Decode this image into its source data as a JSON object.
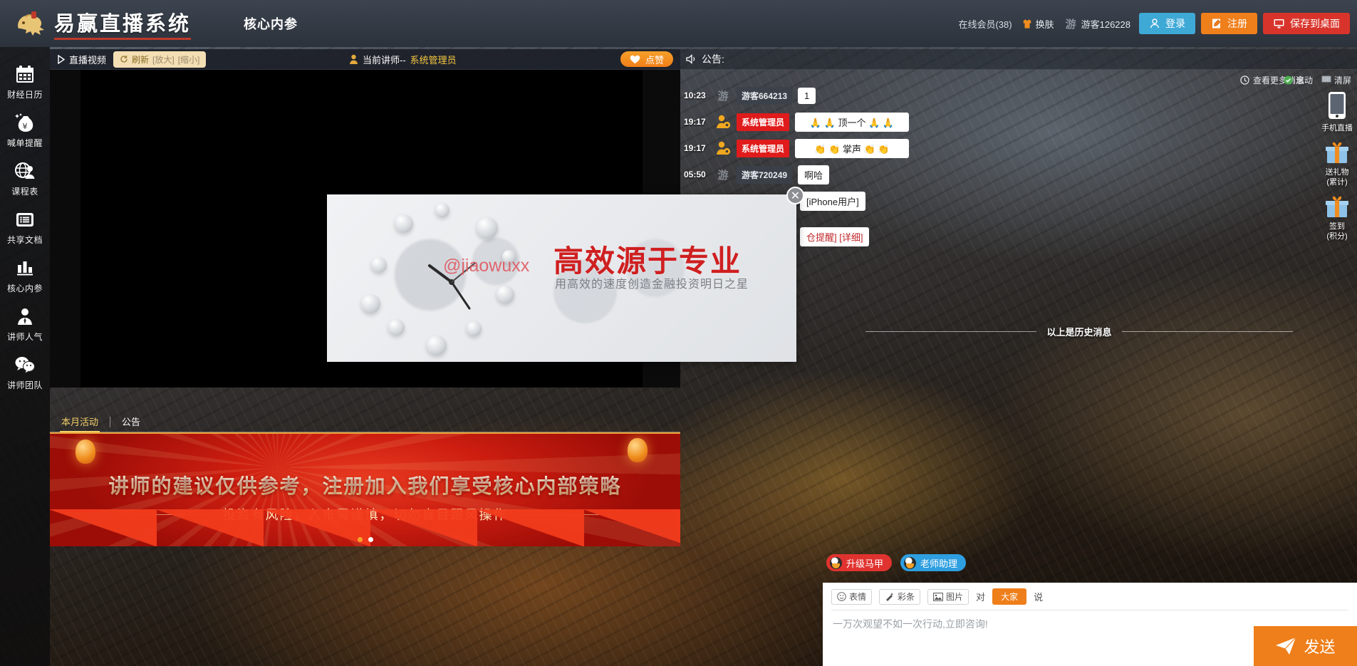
{
  "header": {
    "brand": "易赢直播系统",
    "subtitle": "核心内参",
    "online_members": "在线会员(38)",
    "skin_label": "换肤",
    "guest_badge": "游",
    "guest_name": "游客126228",
    "login_label": "登录",
    "register_label": "注册",
    "save_desktop_label": "保存到桌面"
  },
  "sidebar": {
    "items": [
      {
        "label": "财经日历",
        "icon": "calendar-icon"
      },
      {
        "label": "喊单提醒",
        "icon": "money-bag-icon"
      },
      {
        "label": "课程表",
        "icon": "globe-person-icon"
      },
      {
        "label": "共享文档",
        "icon": "document-list-icon"
      },
      {
        "label": "核心内参",
        "icon": "bar-chart-icon"
      },
      {
        "label": "讲师人气",
        "icon": "person-icon"
      },
      {
        "label": "讲师团队",
        "icon": "wechat-icon"
      }
    ]
  },
  "video": {
    "toolbar_title": "直播视频",
    "refresh_label": "刷新",
    "zoom_in_label": "[放大]",
    "zoom_out_label": "[缩小]",
    "teacher_prefix": "当前讲师--",
    "teacher_name": "系统管理员",
    "like_label": "点赞"
  },
  "popup": {
    "headline": "高效源于专业",
    "subline": "用高效的速度创造金融投资明日之星",
    "watermark": "@jiaowuxx",
    "close_label": "✕"
  },
  "tabs": {
    "items": [
      {
        "label": "本月活动",
        "active": true
      },
      {
        "label": "公告",
        "active": false
      }
    ]
  },
  "banner": {
    "title": "讲师的建议仅供参考，注册加入我们享受核心内部策略",
    "subtitle": "投资有风险，入市需谨慎，切勿盲目跟风操作",
    "dots": 2,
    "active_dot": 1
  },
  "chat": {
    "panel_title": "公告:",
    "more_messages": "查看更多消息",
    "scroll_label": "滚动",
    "clear_label": "清屏",
    "history_divider": "以上是历史消息",
    "messages": [
      {
        "time": "10:23",
        "avatar": "guest",
        "badge": "游",
        "name": "游客664213",
        "name_style": "guest",
        "text": "1"
      },
      {
        "time": "19:17",
        "avatar": "admin",
        "badge": "",
        "name": "系统管理员",
        "name_style": "admin",
        "text": "🙏 🙏 顶一个 🙏 🙏"
      },
      {
        "time": "19:17",
        "avatar": "admin",
        "badge": "",
        "name": "系统管理员",
        "name_style": "admin",
        "text": "👏 👏 掌声 👏 👏"
      },
      {
        "time": "05:50",
        "avatar": "guest",
        "badge": "游",
        "name": "游客720249",
        "name_style": "guest",
        "text": "啊哈"
      }
    ],
    "occluded_messages": [
      {
        "text": "[iPhone用户]"
      },
      {
        "text": "仓提醒] [详细]"
      }
    ]
  },
  "rail": {
    "items": [
      {
        "label": "手机直播",
        "icon": "phone-icon"
      },
      {
        "label": "送礼物\n(累计)",
        "icon": "gift-icon"
      },
      {
        "label": "签到\n(积分)",
        "icon": "gift-icon"
      }
    ],
    "phone_label": "手机直播",
    "gift_label": "送礼物",
    "gift_sub": "(累计)",
    "signin_label": "签到",
    "signin_sub": "(积分)"
  },
  "quick_buttons": [
    {
      "label": "升级马甲",
      "color": "#e0332f"
    },
    {
      "label": "老师助理",
      "color": "#2e9fe0"
    }
  ],
  "input": {
    "emoji_label": "表情",
    "color_label": "彩条",
    "image_label": "图片",
    "to_label": "对",
    "target_label": "大家",
    "say_label": "说",
    "placeholder": "一万次观望不如一次行动,立即咨询!",
    "send_label": "发送"
  },
  "colors": {
    "accent_orange": "#ef7f1a",
    "accent_red": "#d9342b",
    "accent_blue": "#3fa9d6",
    "gold": "#f5c842"
  }
}
